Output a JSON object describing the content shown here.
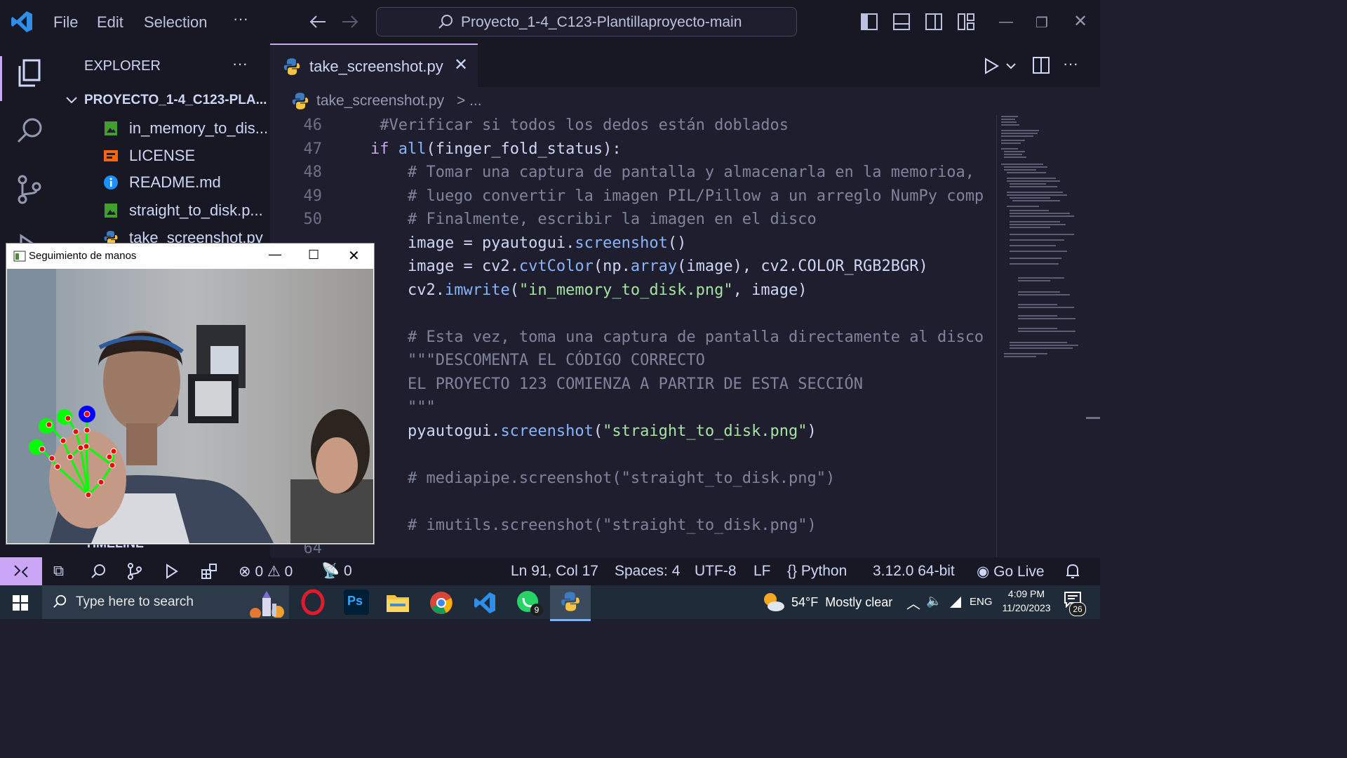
{
  "titlebar": {
    "menu": [
      "File",
      "Edit",
      "Selection",
      "···"
    ],
    "command_center": "Proyecto_1-4_C123-Plantillaproyecto-main"
  },
  "sidebar": {
    "header": "EXPLORER",
    "more": "···",
    "project": "PROYECTO_1-4_C123-PLA...",
    "files": [
      {
        "name": "in_memory_to_dis...",
        "icon": "image-file-icon"
      },
      {
        "name": "LICENSE",
        "icon": "license-icon"
      },
      {
        "name": "README.md",
        "icon": "info-icon"
      },
      {
        "name": "straight_to_disk.p...",
        "icon": "image-file-icon"
      },
      {
        "name": "take_screenshot.py",
        "icon": "python-icon"
      }
    ],
    "timeline": "TIMELINE"
  },
  "editor": {
    "tab_label": "take_screenshot.py",
    "breadcrumb_file": "take_screenshot.py",
    "breadcrumb_rest": "> ...",
    "lines": [
      {
        "n": "46",
        "parts": [
          {
            "c": "cm",
            "t": " #Verificar si todos los dedos están doblados"
          }
        ]
      },
      {
        "n": "47",
        "parts": [
          {
            "c": "kw",
            "t": "if "
          },
          {
            "c": "fn",
            "t": "all"
          },
          {
            "c": "tx",
            "t": "(finger_fold_status):"
          }
        ]
      },
      {
        "n": "48",
        "parts": [
          {
            "c": "cm",
            "t": "    # Tomar una captura de pantalla y almacenarla en la memorioa,"
          }
        ]
      },
      {
        "n": "49",
        "parts": [
          {
            "c": "cm",
            "t": "    # luego convertir la imagen PIL/Pillow a un arreglo NumPy comp"
          }
        ]
      },
      {
        "n": "50",
        "parts": [
          {
            "c": "cm",
            "t": "    # Finalmente, escribir la imagen en el disco"
          }
        ]
      },
      {
        "n": "",
        "parts": [
          {
            "c": "tx",
            "t": "    image = pyautogui."
          },
          {
            "c": "fn",
            "t": "screenshot"
          },
          {
            "c": "tx",
            "t": "()"
          }
        ]
      },
      {
        "n": "",
        "parts": [
          {
            "c": "tx",
            "t": "    image = cv2."
          },
          {
            "c": "fn",
            "t": "cvtColor"
          },
          {
            "c": "tx",
            "t": "(np."
          },
          {
            "c": "fn",
            "t": "array"
          },
          {
            "c": "tx",
            "t": "(image), cv2.COLOR_RGB2BGR)"
          }
        ]
      },
      {
        "n": "",
        "parts": [
          {
            "c": "tx",
            "t": "    cv2."
          },
          {
            "c": "fn",
            "t": "imwrite"
          },
          {
            "c": "tx",
            "t": "("
          },
          {
            "c": "st",
            "t": "\"in_memory_to_disk.png\""
          },
          {
            "c": "tx",
            "t": ", image)"
          }
        ]
      },
      {
        "n": "",
        "parts": []
      },
      {
        "n": "",
        "parts": [
          {
            "c": "cm",
            "t": "    # Esta vez, toma una captura de pantalla directamente al disco"
          }
        ]
      },
      {
        "n": "",
        "parts": [
          {
            "c": "cm",
            "t": "    \"\"\"DESCOMENTA EL CÓDIGO CORRECTO"
          }
        ]
      },
      {
        "n": "",
        "parts": [
          {
            "c": "cm",
            "t": "    EL PROYECTO 123 COMIENZA A PARTIR DE ESTA SECCIÓN"
          }
        ]
      },
      {
        "n": "",
        "parts": [
          {
            "c": "cm",
            "t": "    \"\"\""
          }
        ]
      },
      {
        "n": "",
        "parts": [
          {
            "c": "tx",
            "t": "    pyautogui."
          },
          {
            "c": "fn",
            "t": "screenshot"
          },
          {
            "c": "tx",
            "t": "("
          },
          {
            "c": "st",
            "t": "\"straight_to_disk.png\""
          },
          {
            "c": "tx",
            "t": ")"
          }
        ]
      },
      {
        "n": "",
        "parts": []
      },
      {
        "n": "",
        "parts": [
          {
            "c": "cm",
            "t": "    # mediapipe.screenshot(\"straight_to_disk.png\")"
          }
        ]
      },
      {
        "n": "",
        "parts": []
      },
      {
        "n": "",
        "parts": [
          {
            "c": "cm",
            "t": "    # imutils.screenshot(\"straight_to_disk.png\")"
          }
        ]
      },
      {
        "n": "64",
        "parts": []
      }
    ]
  },
  "camera_window": {
    "title": "Seguimiento de manos"
  },
  "status": {
    "errors": "0",
    "warnings": "0",
    "ports": "0",
    "position": "Ln 91, Col 17",
    "spaces": "Spaces: 4",
    "encoding": "UTF-8",
    "eol": "LF",
    "language": "Python",
    "interpreter": "3.12.0 64-bit",
    "golive": "Go Live"
  },
  "taskbar": {
    "search_placeholder": "Type here to search",
    "weather": "54°F  Mostly clear",
    "lang": "ENG",
    "time": "4:09 PM",
    "date": "11/20/2023",
    "whatsapp_badge": "9",
    "notif_count": "26",
    "ps_label": "Ps"
  },
  "colors": {
    "accent": "#cba6f7",
    "background": "#1e1e2e",
    "taskbar": "#202b3a"
  }
}
